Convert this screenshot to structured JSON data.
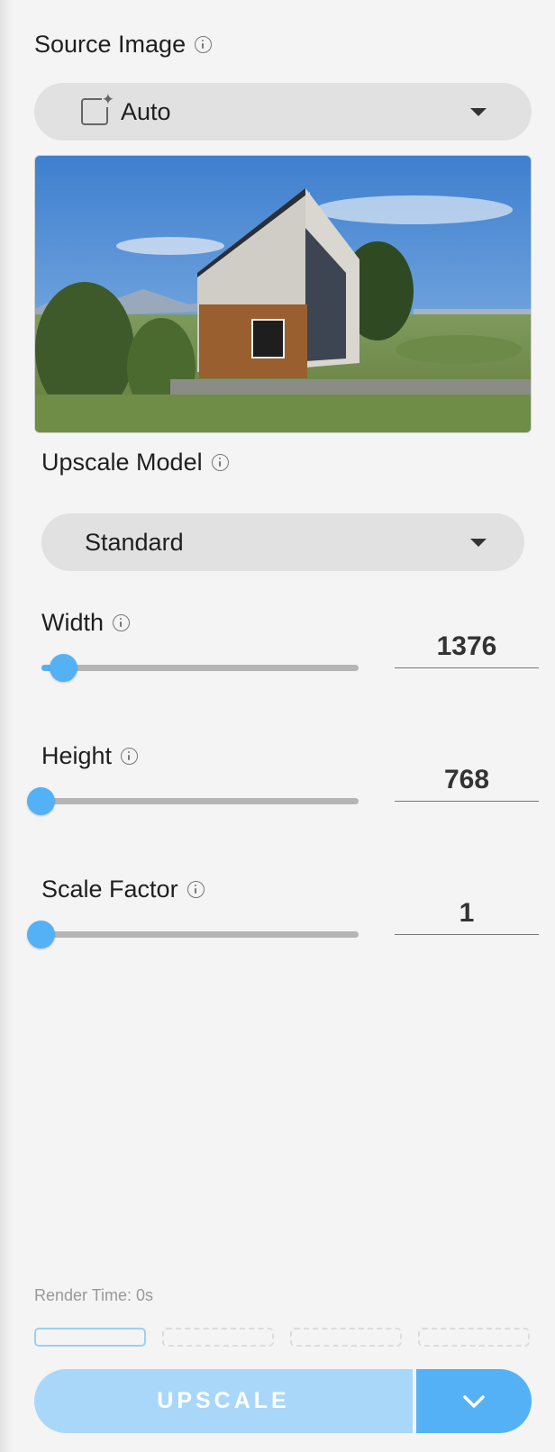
{
  "source": {
    "label": "Source Image",
    "selected": "Auto"
  },
  "model": {
    "label": "Upscale Model",
    "selected": "Standard"
  },
  "width": {
    "label": "Width",
    "value": "1376",
    "level": 0.07
  },
  "height": {
    "label": "Height",
    "value": "768",
    "level": 0.0
  },
  "scale": {
    "label": "Scale Factor",
    "value": "1",
    "level": 0.0
  },
  "render_time": "Render Time: 0s",
  "progress_active_index": 0,
  "upscale_label": "UPSCALE",
  "accent": "#55b1f6",
  "accent_muted": "#a9d7fa",
  "icons": {
    "info": "info-circle-icon",
    "auto": "sparkle-image-icon",
    "caret": "caret-down-icon",
    "menu": "chevron-down-icon"
  }
}
